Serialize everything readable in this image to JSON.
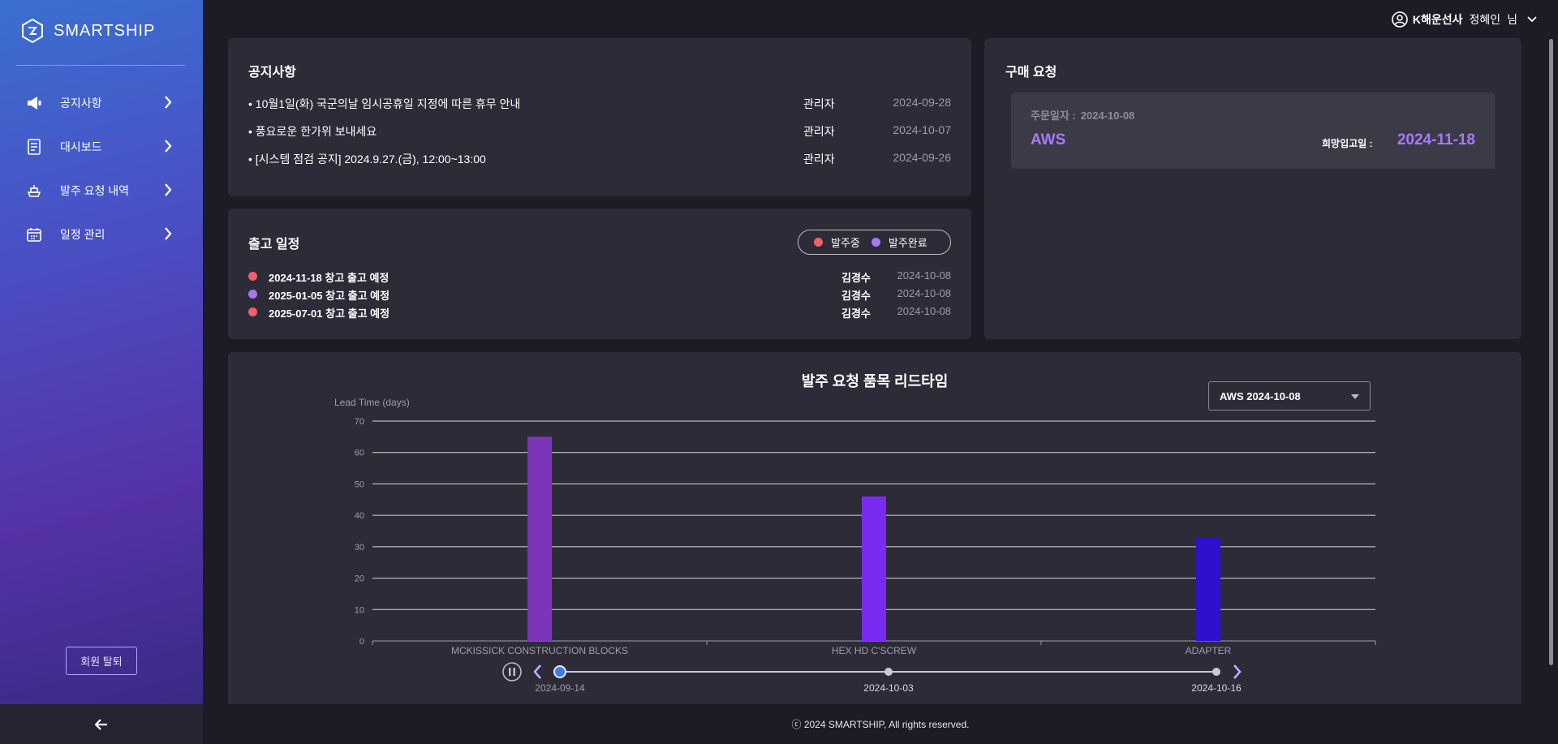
{
  "brand": {
    "name": "SMARTSHIP"
  },
  "sidebar": {
    "items": [
      {
        "label": "공지사항",
        "icon": "megaphone-icon"
      },
      {
        "label": "대시보드",
        "icon": "document-icon"
      },
      {
        "label": "발주 요청 내역",
        "icon": "ship-icon"
      },
      {
        "label": "일정 관리",
        "icon": "calendar-icon"
      }
    ],
    "withdraw_label": "회원 탈퇴"
  },
  "user": {
    "company": "K해운선사",
    "name": "정혜인",
    "suffix": "님"
  },
  "notice": {
    "title": "공지사항",
    "rows": [
      {
        "text": "• 10월1일(화) 국군의날 임시공휴일 지정에 따른 휴무 안내",
        "author": "관리자",
        "date": "2024-09-28"
      },
      {
        "text": "• 풍요로운 한가위 보내세요",
        "author": "관리자",
        "date": "2024-10-07"
      },
      {
        "text": "• [시스템 점검 공지] 2024.9.27.(금), 12:00~13:00",
        "author": "관리자",
        "date": "2024-09-26"
      }
    ]
  },
  "shipping": {
    "title": "출고 일정",
    "legend": [
      {
        "label": "발주중",
        "color": "#f0606a"
      },
      {
        "label": "발주완료",
        "color": "#a879f0"
      }
    ],
    "rows": [
      {
        "text": "2024-11-18 창고 출고 예정",
        "who": "김경수",
        "date": "2024-10-08",
        "color": "#f0606a"
      },
      {
        "text": "2025-01-05 창고 출고 예정",
        "who": "김경수",
        "date": "2024-10-08",
        "color": "#a879f0"
      },
      {
        "text": "2025-07-01 창고 출고 예정",
        "who": "김경수",
        "date": "2024-10-08",
        "color": "#f0606a"
      }
    ]
  },
  "purchase": {
    "title": "구매 요청",
    "order_date_label": "주문일자 :",
    "order_date": "2024-10-08",
    "vendor": "AWS",
    "hope_label": "희망입고일 :",
    "hope_date": "2024-11-18"
  },
  "chart": {
    "select_value": "AWS 2024-10-08",
    "timeline": {
      "labels": [
        "2024-09-14",
        "2024-10-03",
        "2024-10-16"
      ],
      "active_index": 0
    }
  },
  "chart_data": {
    "type": "bar",
    "title": "발주 요청 품목 리드타임",
    "ylabel": "Lead Time (days)",
    "xlabel": "",
    "categories": [
      "MCKISSICK CONSTRUCTION BLOCKS",
      "HEX HD C'SCREW",
      "ADAPTER"
    ],
    "values": [
      65,
      46,
      33
    ],
    "colors": [
      "#7b35b8",
      "#7a2bf2",
      "#2f10cf"
    ],
    "ylim": [
      0,
      70
    ],
    "yticks": [
      0,
      10,
      20,
      30,
      40,
      50,
      60,
      70
    ],
    "grid": true
  },
  "footer": {
    "text": "ⓒ 2024 SMARTSHIP, All rights reserved."
  }
}
